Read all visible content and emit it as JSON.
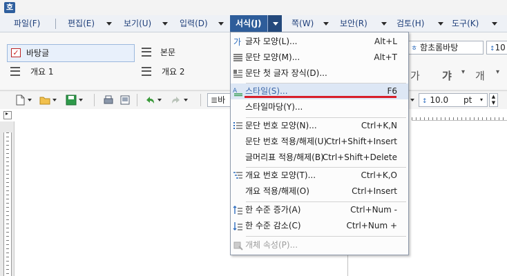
{
  "app": {
    "icon_letter": "호"
  },
  "menubar": {
    "items": [
      {
        "label": "파일(F)"
      },
      {
        "label": "편집(E)"
      },
      {
        "label": "보기(U)"
      },
      {
        "label": "입력(D)"
      },
      {
        "label": "서식(J)"
      },
      {
        "label": "쪽(W)"
      },
      {
        "label": "보안(R)"
      },
      {
        "label": "검토(H)"
      },
      {
        "label": "도구(K)"
      }
    ]
  },
  "styles": {
    "items": [
      {
        "label": "바탕글",
        "selected": true
      },
      {
        "label": "본문",
        "selected": false
      },
      {
        "label": "개요 1",
        "selected": false
      },
      {
        "label": "개요 2",
        "selected": false
      }
    ]
  },
  "font_toolbar": {
    "font_name": "함초롬바탕",
    "font_size_partial": "10",
    "glyphs": [
      "가",
      "갸",
      "개"
    ],
    "spacing_value": "10.0",
    "spacing_unit": "pt",
    "style_combo_partial": "바"
  },
  "format_menu": {
    "items": [
      {
        "label": "글자 모양(L)...",
        "shortcut": "Alt+L",
        "icon": "char-shape-icon",
        "disabled": false,
        "highlighted": false
      },
      {
        "label": "문단 모양(M)...",
        "shortcut": "Alt+T",
        "icon": "para-shape-icon",
        "disabled": false,
        "highlighted": false
      },
      {
        "label": "문단 첫 글자 장식(D)...",
        "shortcut": "",
        "icon": "drop-cap-icon",
        "disabled": false,
        "highlighted": false
      },
      {
        "label": "스타일(S)...",
        "shortcut": "F6",
        "icon": "style-icon",
        "disabled": false,
        "highlighted": true
      },
      {
        "label": "스타일마당(Y)...",
        "shortcut": "",
        "icon": "",
        "disabled": false,
        "highlighted": false
      },
      {
        "label": "문단 번호 모양(N)...",
        "shortcut": "Ctrl+K,N",
        "icon": "numbering-icon",
        "disabled": false,
        "highlighted": false
      },
      {
        "label": "문단 번호 적용/해제(U)",
        "shortcut": "Ctrl+Shift+Insert",
        "icon": "",
        "disabled": false,
        "highlighted": false
      },
      {
        "label": "글머리표 적용/해제(B)",
        "shortcut": "Ctrl+Shift+Delete",
        "icon": "",
        "disabled": false,
        "highlighted": false
      },
      {
        "label": "개요 번호 모양(T)...",
        "shortcut": "Ctrl+K,O",
        "icon": "outline-number-icon",
        "disabled": false,
        "highlighted": false
      },
      {
        "label": "개요 적용/해제(O)",
        "shortcut": "Ctrl+Insert",
        "icon": "",
        "disabled": false,
        "highlighted": false
      },
      {
        "label": "한 수준 증가(A)",
        "shortcut": "Ctrl+Num -",
        "icon": "level-up-icon",
        "disabled": false,
        "highlighted": false
      },
      {
        "label": "한 수준 감소(C)",
        "shortcut": "Ctrl+Num +",
        "icon": "level-down-icon",
        "disabled": false,
        "highlighted": false
      },
      {
        "label": "개체 속성(P)...",
        "shortcut": "",
        "icon": "object-props-icon",
        "disabled": true,
        "highlighted": false
      }
    ]
  },
  "colors": {
    "menu_active": "#2e5d9a",
    "highlight": "#dde7f5",
    "annotation_red": "#d81e2a",
    "menu_text": "#1f3f7a"
  }
}
